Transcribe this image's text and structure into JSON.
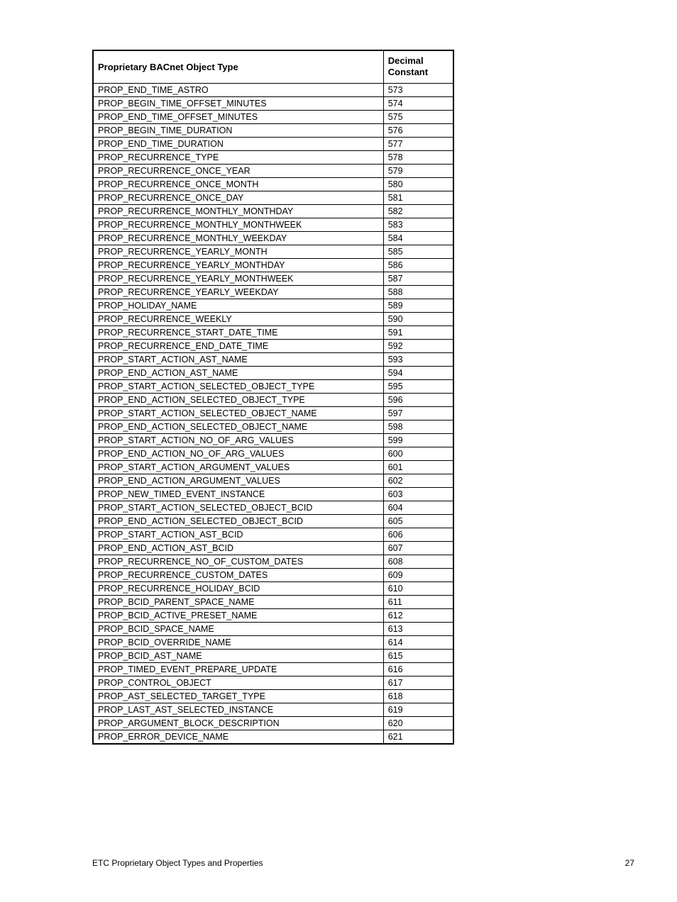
{
  "table": {
    "headers": {
      "type": "Proprietary BACnet Object Type",
      "constant_line1": "Decimal",
      "constant_line2": "Constant"
    },
    "rows": [
      {
        "name": "PROP_END_TIME_ASTRO",
        "value": "573"
      },
      {
        "name": "PROP_BEGIN_TIME_OFFSET_MINUTES",
        "value": "574"
      },
      {
        "name": "PROP_END_TIME_OFFSET_MINUTES",
        "value": "575"
      },
      {
        "name": "PROP_BEGIN_TIME_DURATION",
        "value": "576"
      },
      {
        "name": "PROP_END_TIME_DURATION",
        "value": "577"
      },
      {
        "name": "PROP_RECURRENCE_TYPE",
        "value": "578"
      },
      {
        "name": "PROP_RECURRENCE_ONCE_YEAR",
        "value": "579"
      },
      {
        "name": "PROP_RECURRENCE_ONCE_MONTH",
        "value": "580"
      },
      {
        "name": "PROP_RECURRENCE_ONCE_DAY",
        "value": "581"
      },
      {
        "name": "PROP_RECURRENCE_MONTHLY_MONTHDAY",
        "value": "582"
      },
      {
        "name": "PROP_RECURRENCE_MONTHLY_MONTHWEEK",
        "value": "583"
      },
      {
        "name": "PROP_RECURRENCE_MONTHLY_WEEKDAY",
        "value": "584"
      },
      {
        "name": "PROP_RECURRENCE_YEARLY_MONTH",
        "value": "585"
      },
      {
        "name": "PROP_RECURRENCE_YEARLY_MONTHDAY",
        "value": "586"
      },
      {
        "name": "PROP_RECURRENCE_YEARLY_MONTHWEEK",
        "value": "587"
      },
      {
        "name": "PROP_RECURRENCE_YEARLY_WEEKDAY",
        "value": "588"
      },
      {
        "name": "PROP_HOLIDAY_NAME",
        "value": "589"
      },
      {
        "name": "PROP_RECURRENCE_WEEKLY",
        "value": "590"
      },
      {
        "name": "PROP_RECURRENCE_START_DATE_TIME",
        "value": "591"
      },
      {
        "name": "PROP_RECURRENCE_END_DATE_TIME",
        "value": "592"
      },
      {
        "name": "PROP_START_ACTION_AST_NAME",
        "value": "593"
      },
      {
        "name": "PROP_END_ACTION_AST_NAME",
        "value": "594"
      },
      {
        "name": "PROP_START_ACTION_SELECTED_OBJECT_TYPE",
        "value": "595"
      },
      {
        "name": "PROP_END_ACTION_SELECTED_OBJECT_TYPE",
        "value": "596"
      },
      {
        "name": "PROP_START_ACTION_SELECTED_OBJECT_NAME",
        "value": "597"
      },
      {
        "name": "PROP_END_ACTION_SELECTED_OBJECT_NAME",
        "value": "598"
      },
      {
        "name": "PROP_START_ACTION_NO_OF_ARG_VALUES",
        "value": "599"
      },
      {
        "name": "PROP_END_ACTION_NO_OF_ARG_VALUES",
        "value": "600"
      },
      {
        "name": "PROP_START_ACTION_ARGUMENT_VALUES",
        "value": "601"
      },
      {
        "name": "PROP_END_ACTION_ARGUMENT_VALUES",
        "value": "602"
      },
      {
        "name": "PROP_NEW_TIMED_EVENT_INSTANCE",
        "value": "603"
      },
      {
        "name": "PROP_START_ACTION_SELECTED_OBJECT_BCID",
        "value": "604"
      },
      {
        "name": "PROP_END_ACTION_SELECTED_OBJECT_BCID",
        "value": "605"
      },
      {
        "name": "PROP_START_ACTION_AST_BCID",
        "value": "606"
      },
      {
        "name": "PROP_END_ACTION_AST_BCID",
        "value": "607"
      },
      {
        "name": "PROP_RECURRENCE_NO_OF_CUSTOM_DATES",
        "value": "608"
      },
      {
        "name": "PROP_RECURRENCE_CUSTOM_DATES",
        "value": "609"
      },
      {
        "name": "PROP_RECURRENCE_HOLIDAY_BCID",
        "value": "610"
      },
      {
        "name": "PROP_BCID_PARENT_SPACE_NAME",
        "value": "611"
      },
      {
        "name": "PROP_BCID_ACTIVE_PRESET_NAME",
        "value": "612"
      },
      {
        "name": "PROP_BCID_SPACE_NAME",
        "value": "613"
      },
      {
        "name": "PROP_BCID_OVERRIDE_NAME",
        "value": "614"
      },
      {
        "name": "PROP_BCID_AST_NAME",
        "value": "615"
      },
      {
        "name": "PROP_TIMED_EVENT_PREPARE_UPDATE",
        "value": "616"
      },
      {
        "name": "PROP_CONTROL_OBJECT",
        "value": "617"
      },
      {
        "name": "PROP_AST_SELECTED_TARGET_TYPE",
        "value": "618"
      },
      {
        "name": "PROP_LAST_AST_SELECTED_INSTANCE",
        "value": "619"
      },
      {
        "name": "PROP_ARGUMENT_BLOCK_DESCRIPTION",
        "value": "620"
      },
      {
        "name": "PROP_ERROR_DEVICE_NAME",
        "value": "621"
      }
    ]
  },
  "footer": {
    "left": "ETC Proprietary Object Types and Properties",
    "right": "27"
  }
}
